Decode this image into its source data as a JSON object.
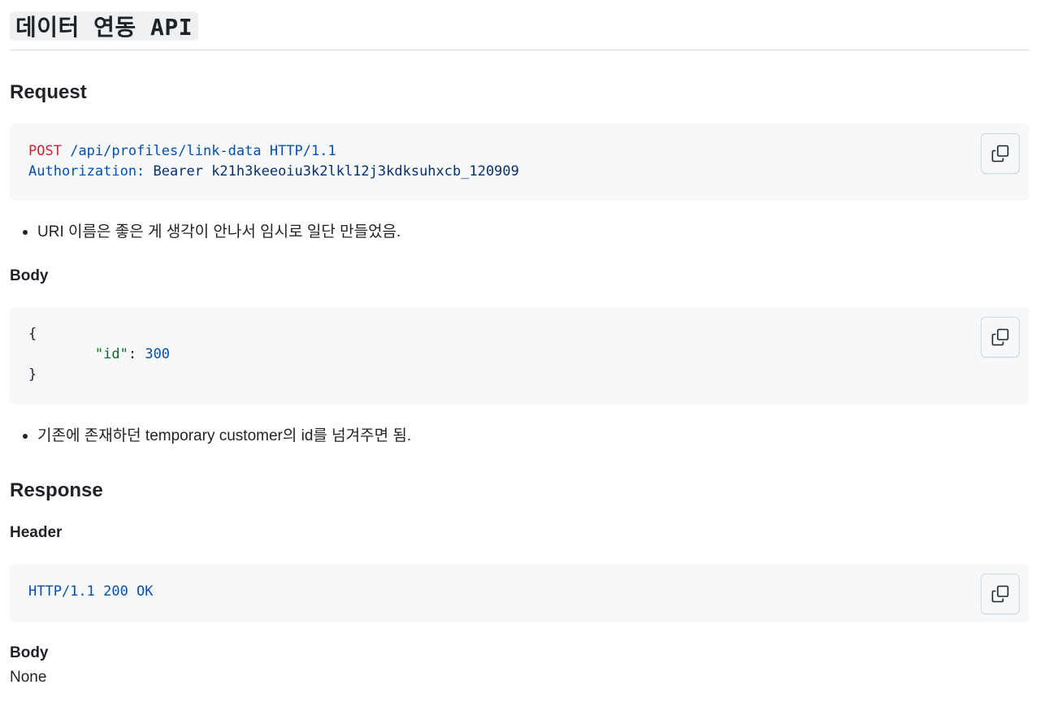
{
  "title": "데이터 연동 API",
  "request": {
    "heading": "Request",
    "code": {
      "method": "POST",
      "path": "/api/profiles/link-data HTTP/1.1",
      "auth_key": "Authorization:",
      "auth_value": "Bearer k21h3keeoiu3k2lkl12j3kdksuhxcb_120909"
    },
    "note": "URI 이름은 좋은 게 생각이 안나서 임시로 일단 만들었음.",
    "body_heading": "Body",
    "body_code": {
      "open": "{",
      "indent": "        ",
      "key": "\"id\"",
      "colon": ": ",
      "value": "300",
      "close": "}"
    },
    "body_note": "기존에 존재하던 temporary customer의 id를 넘겨주면 됨."
  },
  "response": {
    "heading": "Response",
    "header_heading": "Header",
    "header_code": "HTTP/1.1 200 OK",
    "body_heading": "Body",
    "body_value": "None"
  },
  "copy_icon": "copy-icon",
  "colors": {
    "code_bg": "#f6f8fa",
    "keyword_red": "#cf222e",
    "keyword_blue": "#0550ae",
    "string_green": "#116329"
  }
}
